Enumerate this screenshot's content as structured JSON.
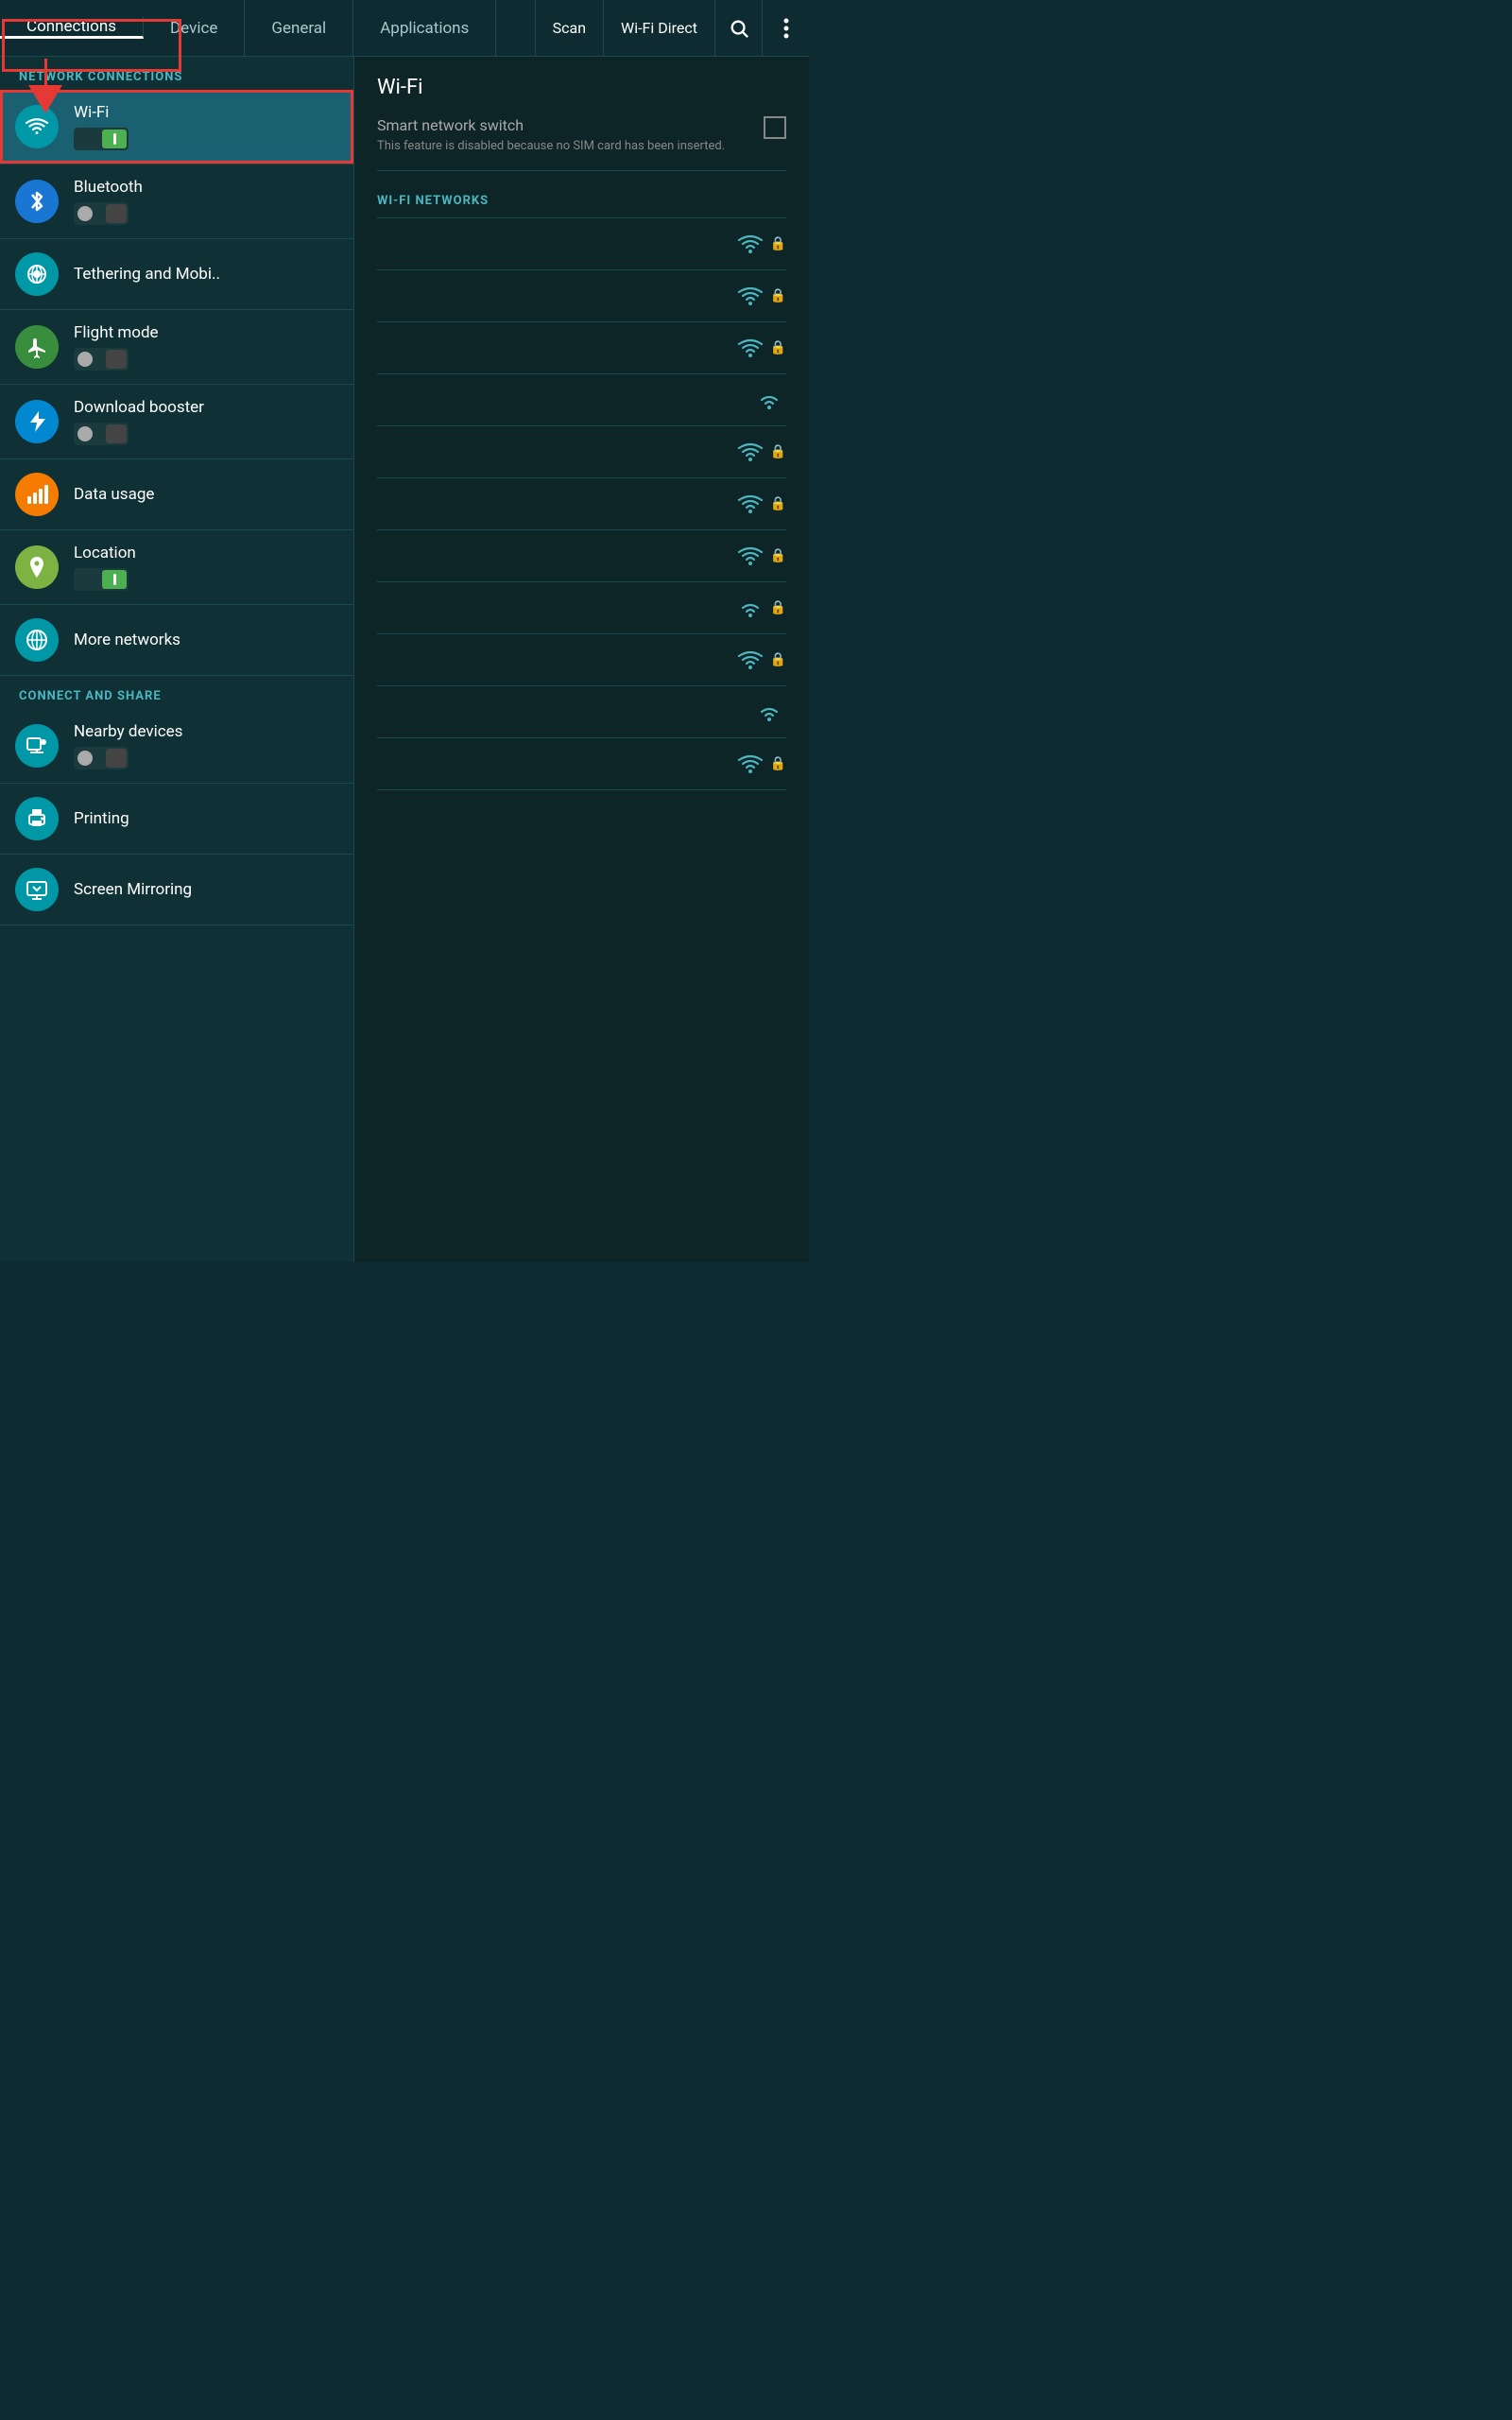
{
  "tabs": [
    {
      "id": "connections",
      "label": "Connections",
      "active": true
    },
    {
      "id": "device",
      "label": "Device",
      "active": false
    },
    {
      "id": "general",
      "label": "General",
      "active": false
    },
    {
      "id": "applications",
      "label": "Applications",
      "active": false
    }
  ],
  "topRight": {
    "scan": "Scan",
    "wifiDirect": "Wi-Fi Direct"
  },
  "sidebar": {
    "networkConnectionsLabel": "NETWORK CONNECTIONS",
    "connectAndShareLabel": "CONNECT AND SHARE",
    "items": [
      {
        "id": "wifi",
        "label": "Wi-Fi",
        "icon": "wifi",
        "iconBg": "icon-teal",
        "toggle": "on",
        "selected": true
      },
      {
        "id": "bluetooth",
        "label": "Bluetooth",
        "icon": "bluetooth",
        "iconBg": "icon-blue",
        "toggle": "off"
      },
      {
        "id": "tethering",
        "label": "Tethering and Mobi..",
        "icon": "tethering",
        "iconBg": "icon-teal"
      },
      {
        "id": "flight",
        "label": "Flight mode",
        "icon": "flight",
        "iconBg": "icon-green",
        "toggle": "off"
      },
      {
        "id": "download",
        "label": "Download booster",
        "icon": "lightning",
        "iconBg": "icon-lightning",
        "toggle": "off"
      },
      {
        "id": "datausage",
        "label": "Data usage",
        "icon": "chart",
        "iconBg": "icon-orange"
      },
      {
        "id": "location",
        "label": "Location",
        "icon": "location",
        "iconBg": "icon-lime",
        "toggle": "on"
      },
      {
        "id": "morenetworks",
        "label": "More networks",
        "icon": "more",
        "iconBg": "icon-purple"
      }
    ],
    "shareItems": [
      {
        "id": "nearby",
        "label": "Nearby devices",
        "icon": "nearby",
        "iconBg": "icon-teal",
        "toggle": "off"
      },
      {
        "id": "printing",
        "label": "Printing",
        "icon": "print",
        "iconBg": "icon-teal"
      },
      {
        "id": "mirroring",
        "label": "Screen Mirroring",
        "icon": "mirror",
        "iconBg": "icon-teal"
      }
    ]
  },
  "rightPanel": {
    "title": "Wi-Fi",
    "smartSwitch": {
      "label": "Smart network switch",
      "desc": "This feature is disabled because no SIM card has been inserted."
    },
    "networksLabel": "WI-FI NETWORKS",
    "networks": [
      {
        "name": "",
        "secured": true,
        "strength": 3
      },
      {
        "name": "",
        "secured": true,
        "strength": 3
      },
      {
        "name": "",
        "secured": true,
        "strength": 3
      },
      {
        "name": "",
        "secured": false,
        "strength": 2
      },
      {
        "name": "",
        "secured": true,
        "strength": 3
      },
      {
        "name": "",
        "secured": true,
        "strength": 3
      },
      {
        "name": "",
        "secured": true,
        "strength": 3
      },
      {
        "name": "",
        "secured": true,
        "strength": 2
      },
      {
        "name": "",
        "secured": true,
        "strength": 3
      },
      {
        "name": "",
        "secured": false,
        "strength": 2
      },
      {
        "name": "",
        "secured": true,
        "strength": 3
      }
    ]
  },
  "colors": {
    "accent": "#4db6c0",
    "background": "#0d2527",
    "sidebarBg": "#0f3035",
    "redAnnotation": "#e53935"
  }
}
